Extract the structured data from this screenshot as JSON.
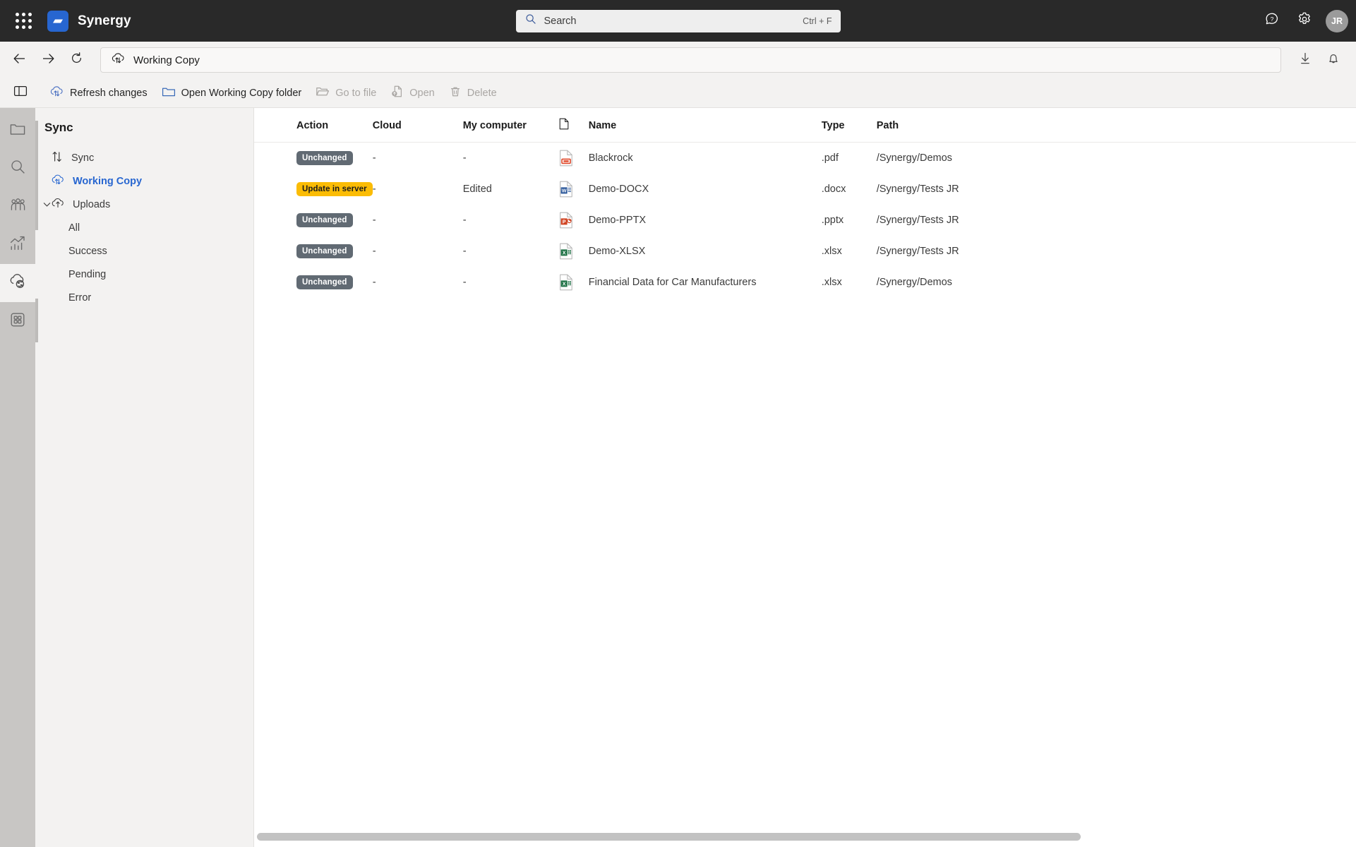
{
  "topbar": {
    "app_name": "Synergy",
    "waffle_icon": "app-launcher-icon",
    "logo_icon": "synergy-logo-icon",
    "search": {
      "placeholder": "Search",
      "shortcut": "Ctrl + F",
      "icon": "search-icon"
    },
    "help_icon": "help-question-bubble-icon",
    "settings_icon": "gear-icon",
    "avatar_initials": "JR"
  },
  "addressbar": {
    "back_icon": "arrow-left-icon",
    "forward_icon": "arrow-right-icon",
    "refresh_icon": "refresh-icon",
    "path_icon": "cloud-sync-icon",
    "path_label": "Working Copy",
    "download_icon": "download-icon",
    "notifications_icon": "bell-icon"
  },
  "commandbar": {
    "toggle_pane_icon": "toggle-left-pane-icon",
    "items": [
      {
        "label": "Refresh changes",
        "icon": "cloud-sync-icon",
        "disabled": false
      },
      {
        "label": "Open Working Copy folder",
        "icon": "folder-icon",
        "disabled": false
      },
      {
        "label": "Go to file",
        "icon": "folder-open-icon",
        "disabled": true
      },
      {
        "label": "Open",
        "icon": "file-open-icon",
        "disabled": true
      },
      {
        "label": "Delete",
        "icon": "trash-icon",
        "disabled": true
      }
    ]
  },
  "rail": {
    "items": [
      {
        "name": "files",
        "icon": "folder-icon",
        "active": false
      },
      {
        "name": "search",
        "icon": "search-icon",
        "active": false
      },
      {
        "name": "teams",
        "icon": "people-group-icon",
        "active": false
      },
      {
        "name": "analytics",
        "icon": "chart-trend-icon",
        "active": false
      },
      {
        "name": "sync",
        "icon": "cloud-sync-icon",
        "active": true
      },
      {
        "name": "apps",
        "icon": "apps-grid-icon",
        "active": false
      }
    ]
  },
  "sidebar": {
    "title": "Sync",
    "items": [
      {
        "label": "Sync",
        "icon": "arrows-up-down-icon",
        "selected": false,
        "child": false,
        "chevron": false
      },
      {
        "label": "Working Copy",
        "icon": "cloud-sync-icon",
        "selected": true,
        "child": false,
        "chevron": false
      },
      {
        "label": "Uploads",
        "icon": "cloud-upload-icon",
        "selected": false,
        "child": false,
        "chevron": true
      },
      {
        "label": "All",
        "icon": "",
        "selected": false,
        "child": true,
        "chevron": false
      },
      {
        "label": "Success",
        "icon": "",
        "selected": false,
        "child": true,
        "chevron": false
      },
      {
        "label": "Pending",
        "icon": "",
        "selected": false,
        "child": true,
        "chevron": false
      },
      {
        "label": "Error",
        "icon": "",
        "selected": false,
        "child": true,
        "chevron": false
      }
    ]
  },
  "table": {
    "columns": [
      {
        "key": "action",
        "label": "Action"
      },
      {
        "key": "cloud",
        "label": "Cloud"
      },
      {
        "key": "mycomputer",
        "label": "My computer"
      },
      {
        "key": "fileicon",
        "label": "",
        "icon": "file-icon"
      },
      {
        "key": "name",
        "label": "Name"
      },
      {
        "key": "type",
        "label": "Type"
      },
      {
        "key": "path",
        "label": "Path"
      }
    ],
    "rows": [
      {
        "action": "Unchanged",
        "action_style": "grey",
        "cloud": "-",
        "mycomputer": "-",
        "fileicon": "pdf-file-icon",
        "name": "Blackrock",
        "type": ".pdf",
        "path": "/Synergy/Demos"
      },
      {
        "action": "Update in server",
        "action_style": "amber",
        "cloud": "-",
        "mycomputer": "Edited",
        "fileicon": "word-file-icon",
        "name": "Demo-DOCX",
        "type": ".docx",
        "path": "/Synergy/Tests JR"
      },
      {
        "action": "Unchanged",
        "action_style": "grey",
        "cloud": "-",
        "mycomputer": "-",
        "fileicon": "powerpoint-file-icon",
        "name": "Demo-PPTX",
        "type": ".pptx",
        "path": "/Synergy/Tests JR"
      },
      {
        "action": "Unchanged",
        "action_style": "grey",
        "cloud": "-",
        "mycomputer": "-",
        "fileicon": "excel-file-icon",
        "name": "Demo-XLSX",
        "type": ".xlsx",
        "path": "/Synergy/Tests JR"
      },
      {
        "action": "Unchanged",
        "action_style": "grey",
        "cloud": "-",
        "mycomputer": "-",
        "fileicon": "excel-file-icon",
        "name": "Financial Data for Car Manufacturers",
        "type": ".xlsx",
        "path": "/Synergy/Demos"
      }
    ]
  },
  "colors": {
    "topbar_bg": "#292929",
    "accent_blue": "#2766d0",
    "badge_grey": "#616a73",
    "badge_amber": "#fbbc05",
    "chrome_bg": "#f3f2f1",
    "rail_bg": "#c8c6c4"
  }
}
